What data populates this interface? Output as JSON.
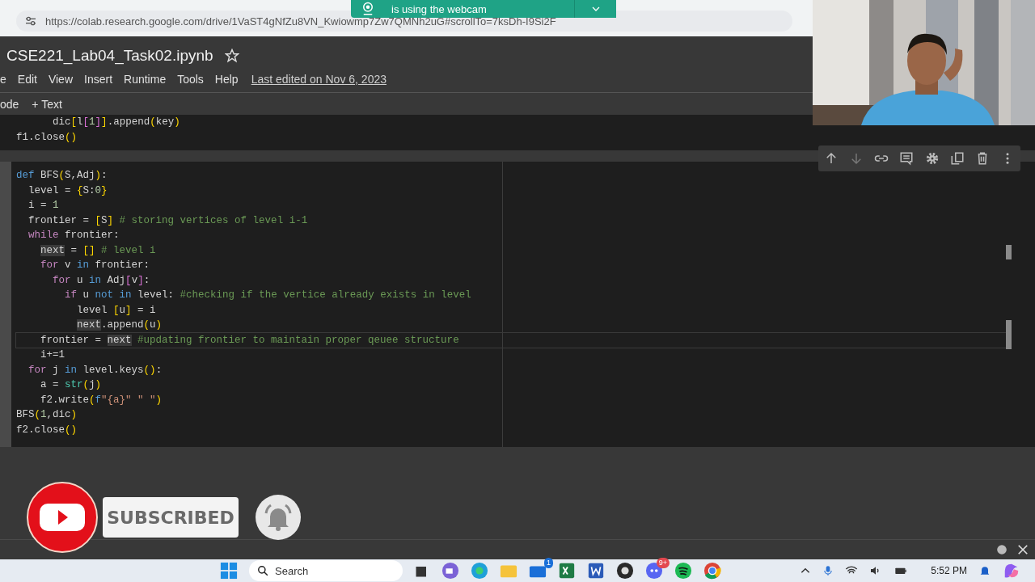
{
  "browser": {
    "url": "https://colab.research.google.com/drive/1VaST4gNfZu8VN_Kwiowmp7Zw7QMNh2uG#scrollTo=7ksDh-I9Si2F"
  },
  "notification": {
    "text": "is using the webcam"
  },
  "notebook": {
    "title": "CSE221_Lab04_Task02.ipynb",
    "menu": [
      "e",
      "Edit",
      "View",
      "Insert",
      "Runtime",
      "Tools",
      "Help"
    ],
    "last_edited": "Last edited on Nov 6, 2023",
    "toolbar": [
      "ode",
      "+ Text"
    ]
  },
  "cells": [
    {
      "selected": false,
      "lines": [
        {
          "current": false,
          "tokens": [
            {
              "text": "      dic",
              "kind": "plain"
            },
            {
              "text": "[",
              "kind": "bracket"
            },
            {
              "text": "l",
              "kind": "plain"
            },
            {
              "text": "[",
              "kind": "inner"
            },
            {
              "text": "1",
              "kind": "number"
            },
            {
              "text": "]",
              "kind": "inner"
            },
            {
              "text": "]",
              "kind": "bracket"
            },
            {
              "text": ".append",
              "kind": "plain"
            },
            {
              "text": "(",
              "kind": "bracket"
            },
            {
              "text": "key",
              "kind": "plain"
            },
            {
              "text": ")",
              "kind": "bracket"
            }
          ]
        },
        {
          "current": false,
          "tokens": [
            {
              "text": "f1.close",
              "kind": "plain"
            },
            {
              "text": "()",
              "kind": "bracket"
            }
          ]
        }
      ]
    },
    {
      "selected": true,
      "lines": [
        {
          "current": false,
          "tokens": [
            {
              "text": "def ",
              "kind": "keyword2"
            },
            {
              "text": "BFS",
              "kind": "plain"
            },
            {
              "text": "(",
              "kind": "bracket"
            },
            {
              "text": "S,Adj",
              "kind": "plain"
            },
            {
              "text": ")",
              "kind": "bracket"
            },
            {
              "text": ":",
              "kind": "plain"
            }
          ]
        },
        {
          "current": false,
          "tokens": [
            {
              "text": "  level = ",
              "kind": "plain"
            },
            {
              "text": "{",
              "kind": "bracket"
            },
            {
              "text": "S:",
              "kind": "plain"
            },
            {
              "text": "0",
              "kind": "number"
            },
            {
              "text": "}",
              "kind": "bracket"
            }
          ]
        },
        {
          "current": false,
          "tokens": [
            {
              "text": "  i = ",
              "kind": "plain"
            },
            {
              "text": "1",
              "kind": "number"
            }
          ]
        },
        {
          "current": false,
          "tokens": [
            {
              "text": "  frontier = ",
              "kind": "plain"
            },
            {
              "text": "[",
              "kind": "bracket"
            },
            {
              "text": "S",
              "kind": "plain"
            },
            {
              "text": "]",
              "kind": "bracket"
            },
            {
              "text": " # storing vertices of level i-1",
              "kind": "comment"
            }
          ]
        },
        {
          "current": false,
          "tokens": [
            {
              "text": "  while",
              "kind": "keyword"
            },
            {
              "text": " frontier:",
              "kind": "plain"
            }
          ]
        },
        {
          "current": false,
          "tokens": [
            {
              "text": "    next",
              "kind": "highlight"
            },
            {
              "text": " = ",
              "kind": "plain"
            },
            {
              "text": "[]",
              "kind": "bracket"
            },
            {
              "text": " # level i",
              "kind": "comment"
            }
          ]
        },
        {
          "current": false,
          "tokens": [
            {
              "text": "    for",
              "kind": "keyword"
            },
            {
              "text": " v ",
              "kind": "plain"
            },
            {
              "text": "in",
              "kind": "keyword2"
            },
            {
              "text": " frontier:",
              "kind": "plain"
            }
          ]
        },
        {
          "current": false,
          "tokens": [
            {
              "text": "      for",
              "kind": "keyword"
            },
            {
              "text": " u ",
              "kind": "plain"
            },
            {
              "text": "in",
              "kind": "keyword2"
            },
            {
              "text": " Adj",
              "kind": "plain"
            },
            {
              "text": "[",
              "kind": "inner"
            },
            {
              "text": "v",
              "kind": "plain"
            },
            {
              "text": "]",
              "kind": "inner"
            },
            {
              "text": ":",
              "kind": "plain"
            }
          ]
        },
        {
          "current": false,
          "tokens": [
            {
              "text": "        if",
              "kind": "keyword"
            },
            {
              "text": " u ",
              "kind": "plain"
            },
            {
              "text": "not in",
              "kind": "keyword2"
            },
            {
              "text": " level: ",
              "kind": "plain"
            },
            {
              "text": "#checking if the vertice already exists in level",
              "kind": "comment"
            }
          ]
        },
        {
          "current": false,
          "tokens": [
            {
              "text": "          level ",
              "kind": "plain"
            },
            {
              "text": "[",
              "kind": "bracket"
            },
            {
              "text": "u",
              "kind": "plain"
            },
            {
              "text": "]",
              "kind": "bracket"
            },
            {
              "text": " = i",
              "kind": "plain"
            }
          ]
        },
        {
          "current": false,
          "tokens": [
            {
              "text": "          next",
              "kind": "highlight"
            },
            {
              "text": ".append",
              "kind": "plain"
            },
            {
              "text": "(",
              "kind": "bracket"
            },
            {
              "text": "u",
              "kind": "plain"
            },
            {
              "text": ")",
              "kind": "bracket"
            }
          ]
        },
        {
          "current": true,
          "tokens": [
            {
              "text": "    frontier = ",
              "kind": "plain"
            },
            {
              "text": "next",
              "kind": "highlight"
            },
            {
              "text": " #updating frontier to maintain proper qeuee structure",
              "kind": "comment"
            }
          ]
        },
        {
          "current": false,
          "tokens": [
            {
              "text": "    i+=1",
              "kind": "plain"
            }
          ]
        },
        {
          "current": false,
          "tokens": [
            {
              "text": "  for",
              "kind": "keyword"
            },
            {
              "text": " j ",
              "kind": "plain"
            },
            {
              "text": "in",
              "kind": "keyword2"
            },
            {
              "text": " level.keys",
              "kind": "plain"
            },
            {
              "text": "()",
              "kind": "bracket"
            },
            {
              "text": ":",
              "kind": "plain"
            }
          ]
        },
        {
          "current": false,
          "tokens": [
            {
              "text": "    a = ",
              "kind": "plain"
            },
            {
              "text": "str",
              "kind": "builtin"
            },
            {
              "text": "(",
              "kind": "bracket"
            },
            {
              "text": "j",
              "kind": "plain"
            },
            {
              "text": ")",
              "kind": "bracket"
            }
          ]
        },
        {
          "current": false,
          "tokens": [
            {
              "text": "    f2.write",
              "kind": "plain"
            },
            {
              "text": "(",
              "kind": "bracket"
            },
            {
              "text": "f",
              "kind": "keyword2"
            },
            {
              "text": "\"{a}\" \" \"",
              "kind": "string"
            },
            {
              "text": ")",
              "kind": "bracket"
            }
          ]
        },
        {
          "current": false,
          "tokens": [
            {
              "text": "BFS",
              "kind": "plain"
            },
            {
              "text": "(",
              "kind": "bracket"
            },
            {
              "text": "1",
              "kind": "number"
            },
            {
              "text": ",dic",
              "kind": "plain"
            },
            {
              "text": ")",
              "kind": "bracket"
            }
          ]
        },
        {
          "current": false,
          "tokens": [
            {
              "text": "f2.close",
              "kind": "plain"
            },
            {
              "text": "()",
              "kind": "bracket"
            }
          ]
        }
      ]
    }
  ],
  "overlay": {
    "subscribe": "SUBSCRIBED"
  },
  "taskbar": {
    "search": "Search",
    "mail_badge": "1",
    "chat_badge": "9+",
    "time": "5:52 PM"
  }
}
